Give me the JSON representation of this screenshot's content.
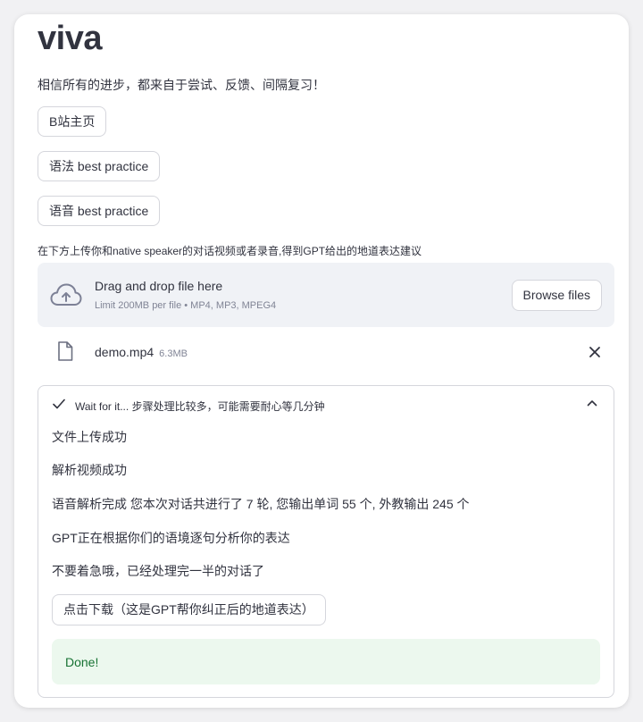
{
  "app": {
    "title": "viva",
    "tagline": "相信所有的进步，都来自于尝试、反馈、间隔复习！"
  },
  "links": [
    {
      "label": "B站主页"
    },
    {
      "label": "语法 best practice"
    },
    {
      "label": "语音 best practice"
    }
  ],
  "uploader": {
    "label": "在下方上传你和native speaker的对话视频或者录音,得到GPT给出的地道表达建议",
    "drop_title": "Drag and drop file here",
    "drop_limit": "Limit 200MB per file • MP4, MP3, MPEG4",
    "browse_label": "Browse files",
    "file": {
      "name": "demo.mp4",
      "size": "6.3MB"
    }
  },
  "status": {
    "title": "Wait for it... 步骤处理比较多，可能需要耐心等几分钟",
    "messages": [
      "文件上传成功",
      "解析视频成功",
      "语音解析完成 您本次对话共进行了 7 轮, 您输出单词 55 个, 外教输出 245 个",
      "GPT正在根据你们的语境逐句分析你的表达",
      "不要着急哦，已经处理完一半的对话了"
    ],
    "download_label": "点击下载（这是GPT帮你纠正后的地道表达）",
    "success": "Done!"
  },
  "icons": {
    "upload": "cloud-upload-icon",
    "file": "file-icon",
    "remove": "close-icon",
    "done": "check-icon",
    "collapse": "chevron-up-icon"
  },
  "colors": {
    "text": "#31333f",
    "muted": "#808495",
    "dropzone_bg": "#f0f2f6",
    "success_bg": "#ecf8ee",
    "success_text": "#177233"
  }
}
